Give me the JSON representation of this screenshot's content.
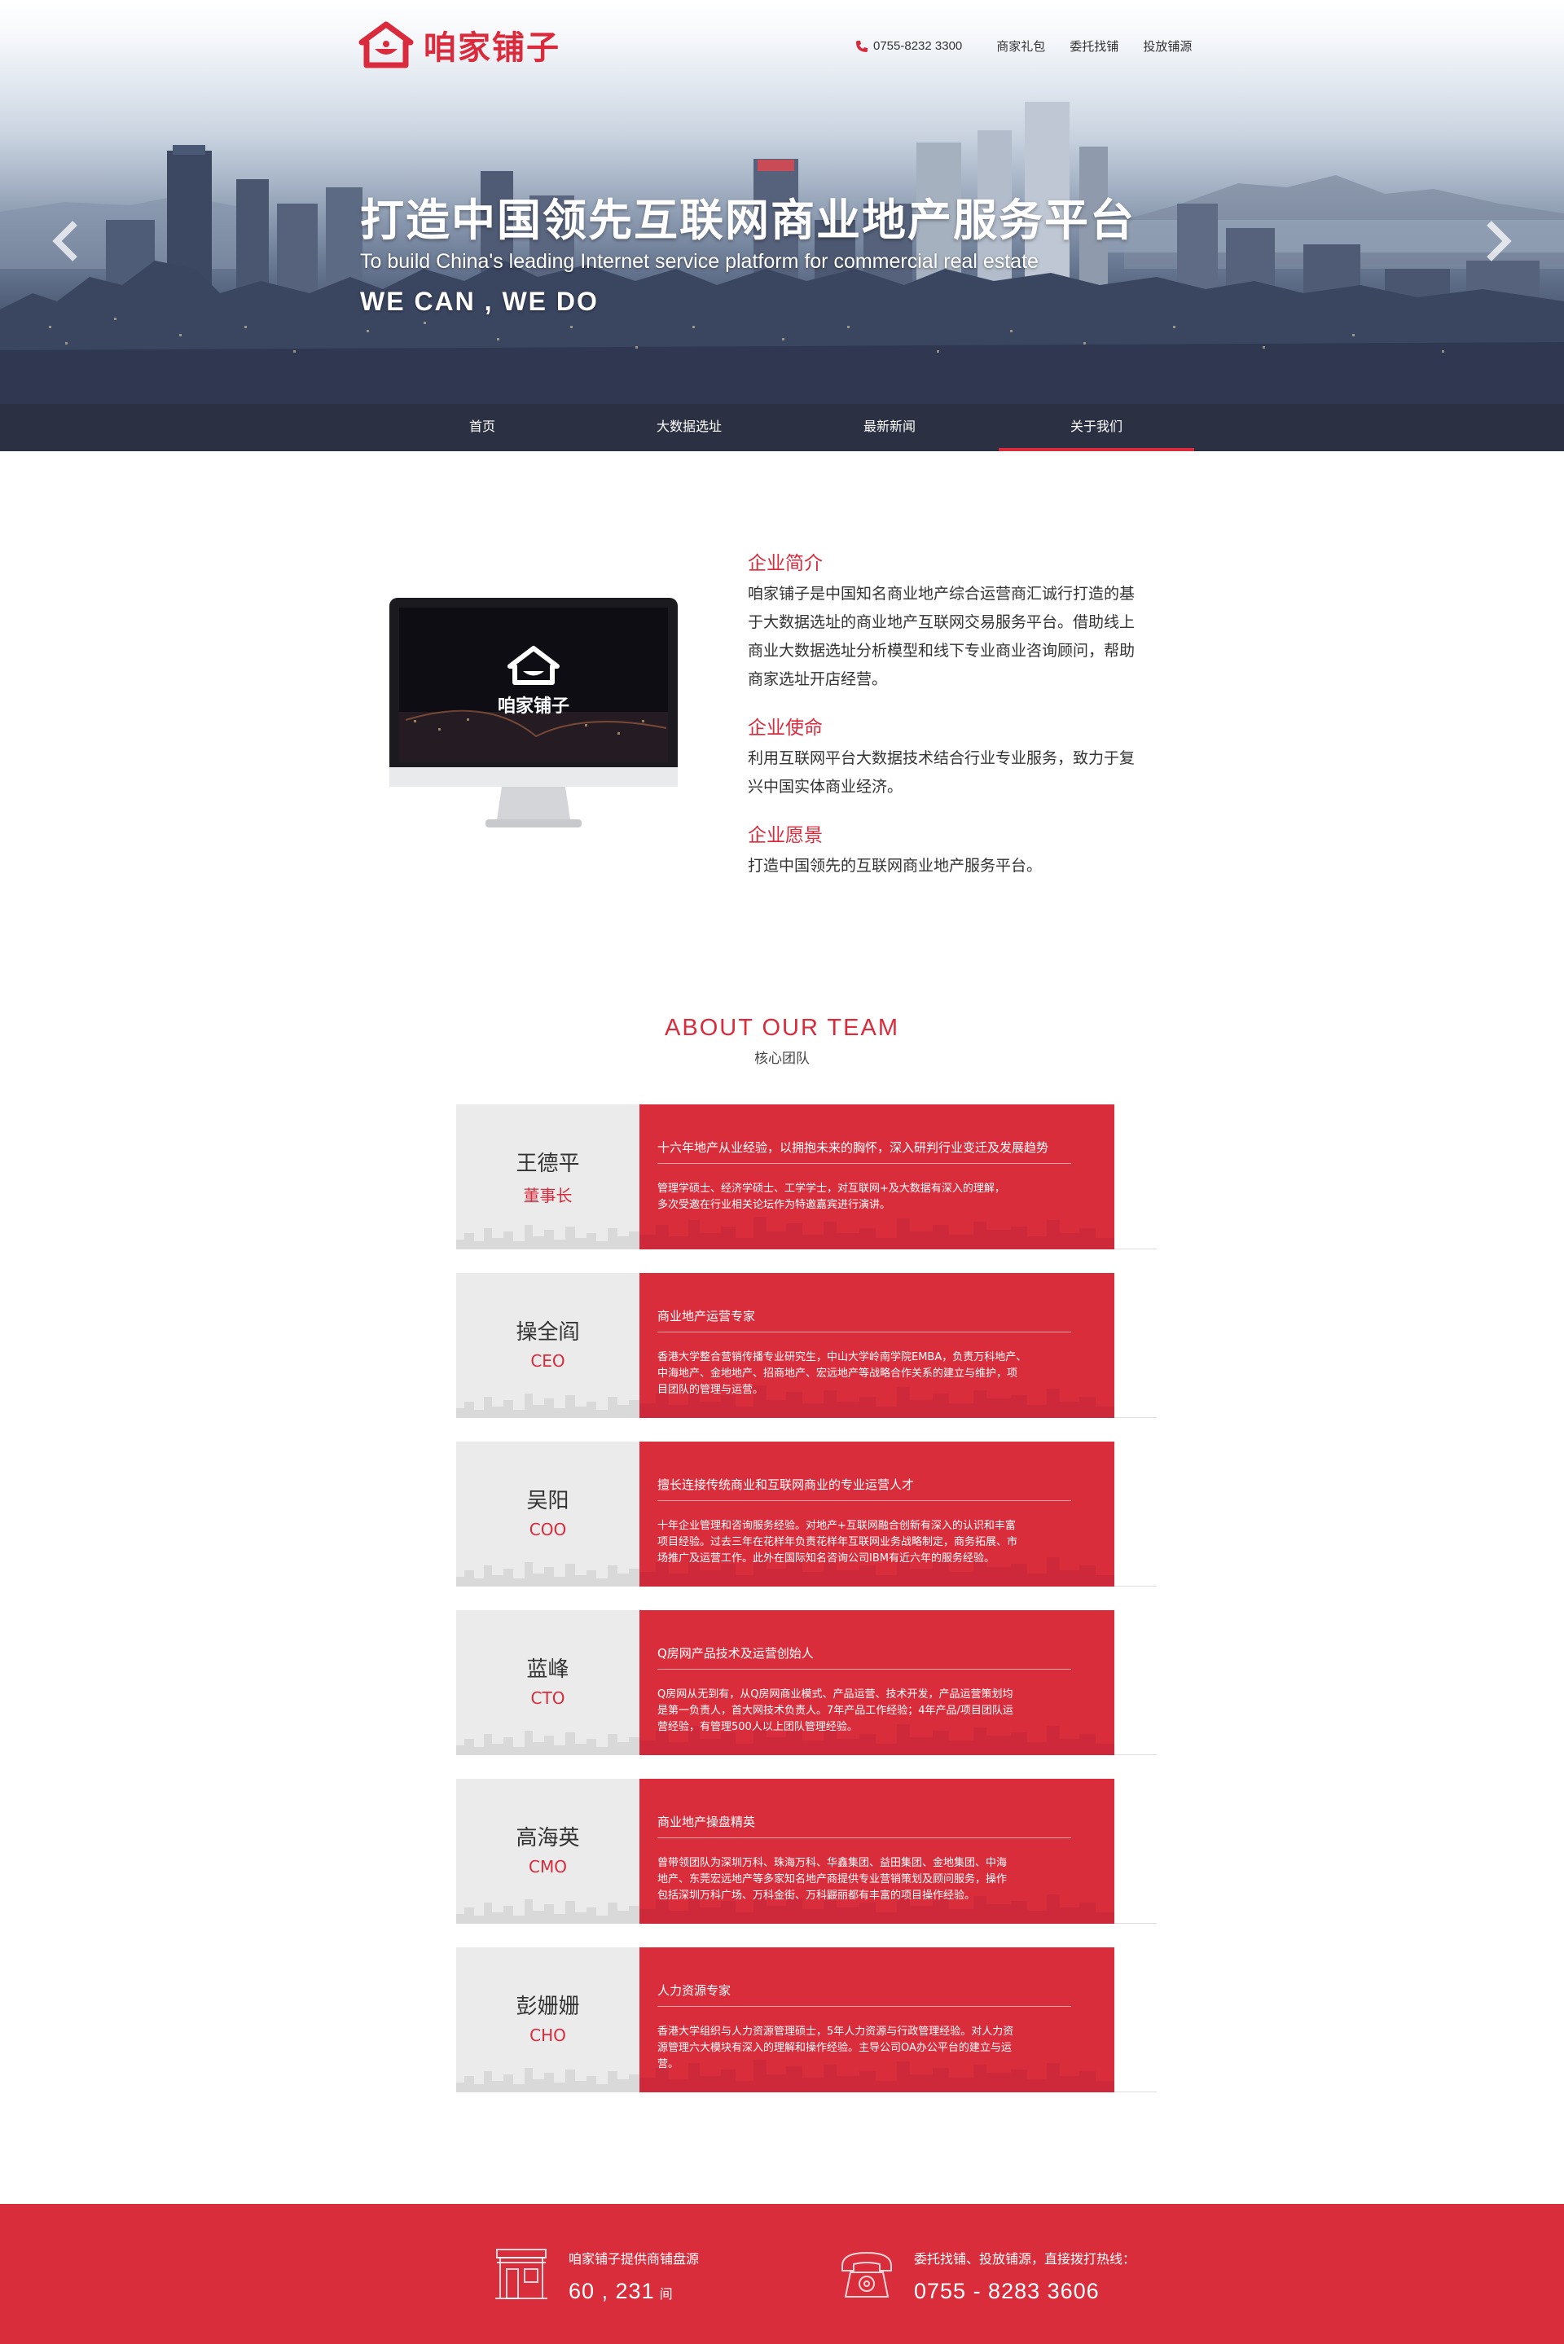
{
  "brand": {
    "logo_text": "咱家铺子",
    "accent": "#d92b3c"
  },
  "topnav": {
    "phone": "0755-8232 3300",
    "links": [
      "商家礼包",
      "委托找铺",
      "投放铺源"
    ]
  },
  "hero": {
    "slogan_cn": "打造中国领先互联网商业地产服务平台",
    "slogan_en": "To build China's leading Internet service platform for commercial real estate",
    "slogan_tag": "WE CAN , WE DO"
  },
  "mainnav": {
    "items": [
      "首页",
      "大数据选址",
      "最新新闻",
      "关于我们"
    ],
    "active": "关于我们"
  },
  "intro": {
    "monitor_logo_text": "咱家铺子",
    "blocks": [
      {
        "title": "企业简介",
        "lines": [
          "咱家铺子是中国知名商业地产综合运营商汇诚行打造的基",
          "于大数据选址的商业地产互联网交易服务平台。借助线上",
          "商业大数据选址分析模型和线下专业商业咨询顾问，帮助",
          "商家选址开店经营。"
        ]
      },
      {
        "title": "企业使命",
        "lines": [
          "利用互联网平台大数据技术结合行业专业服务，致力于复",
          "兴中国实体商业经济。"
        ]
      },
      {
        "title": "企业愿景",
        "lines": [
          "打造中国领先的互联网商业地产服务平台。"
        ]
      }
    ]
  },
  "team": {
    "title_en": "ABOUT  OUR  TEAM",
    "title_cn": "核心团队",
    "members": [
      {
        "name": "王德平",
        "role": "董事长",
        "headline": "十六年地产从业经验，以拥抱未来的胸怀，深入研判行业变迁及发展趋势",
        "desc": [
          "管理学硕士、经济学硕士、工学学士，对互联网+及大数据有深入的理解，",
          "多次受邀在行业相关论坛作为特邀嘉宾进行演讲。"
        ]
      },
      {
        "name": "操全阎",
        "role": "CEO",
        "headline": "商业地产运营专家",
        "desc": [
          "香港大学整合营销传播专业研究生，中山大学岭南学院EMBA，负责万科地产、",
          "中海地产、金地地产、招商地产、宏远地产等战略合作关系的建立与维护，项",
          "目团队的管理与运营。"
        ]
      },
      {
        "name": "吴阳",
        "role": "COO",
        "headline": "擅长连接传统商业和互联网商业的专业运营人才",
        "desc": [
          "十年企业管理和咨询服务经验。对地产+互联网融合创新有深入的认识和丰富",
          "项目经验。过去三年在花样年负责花样年互联网业务战略制定，商务拓展、市",
          "场推广及运营工作。此外在国际知名咨询公司IBM有近六年的服务经验。"
        ]
      },
      {
        "name": "蓝峰",
        "role": "CTO",
        "headline": "Q房网产品技术及运营创始人",
        "desc": [
          "Q房网从无到有，从Q房网商业模式、产品运营、技术开发，产品运营策划均",
          "是第一负责人，首大网技术负责人。7年产品工作经验；4年产品/项目团队运",
          "营经验，有管理500人以上团队管理经验。"
        ]
      },
      {
        "name": "高海英",
        "role": "CMO",
        "headline": "商业地产操盘精英",
        "desc": [
          "曾带领团队为深圳万科、珠海万科、华鑫集团、益田集团、金地集团、中海",
          "地产、东莞宏远地产等多家知名地产商提供专业营销策划及顾问服务，操作",
          "包括深圳万科广场、万科金街、万科鼹丽都有丰富的项目操作经验。"
        ]
      },
      {
        "name": "彭姗姗",
        "role": "CHO",
        "headline": "人力资源专家",
        "desc": [
          "香港大学组织与人力资源管理硕士，5年人力资源与行政管理经验。对人力资",
          "源管理六大模块有深入的理解和操作经验。主导公司OA办公平台的建立与运",
          "营。"
        ]
      }
    ]
  },
  "footer": {
    "left_label": "咱家铺子提供商铺盘源",
    "left_number": "60 , 231",
    "left_unit": "间",
    "right_label": "委托找铺、投放铺源，直接拨打热线：",
    "right_phone": "0755 - 8283 3606"
  }
}
